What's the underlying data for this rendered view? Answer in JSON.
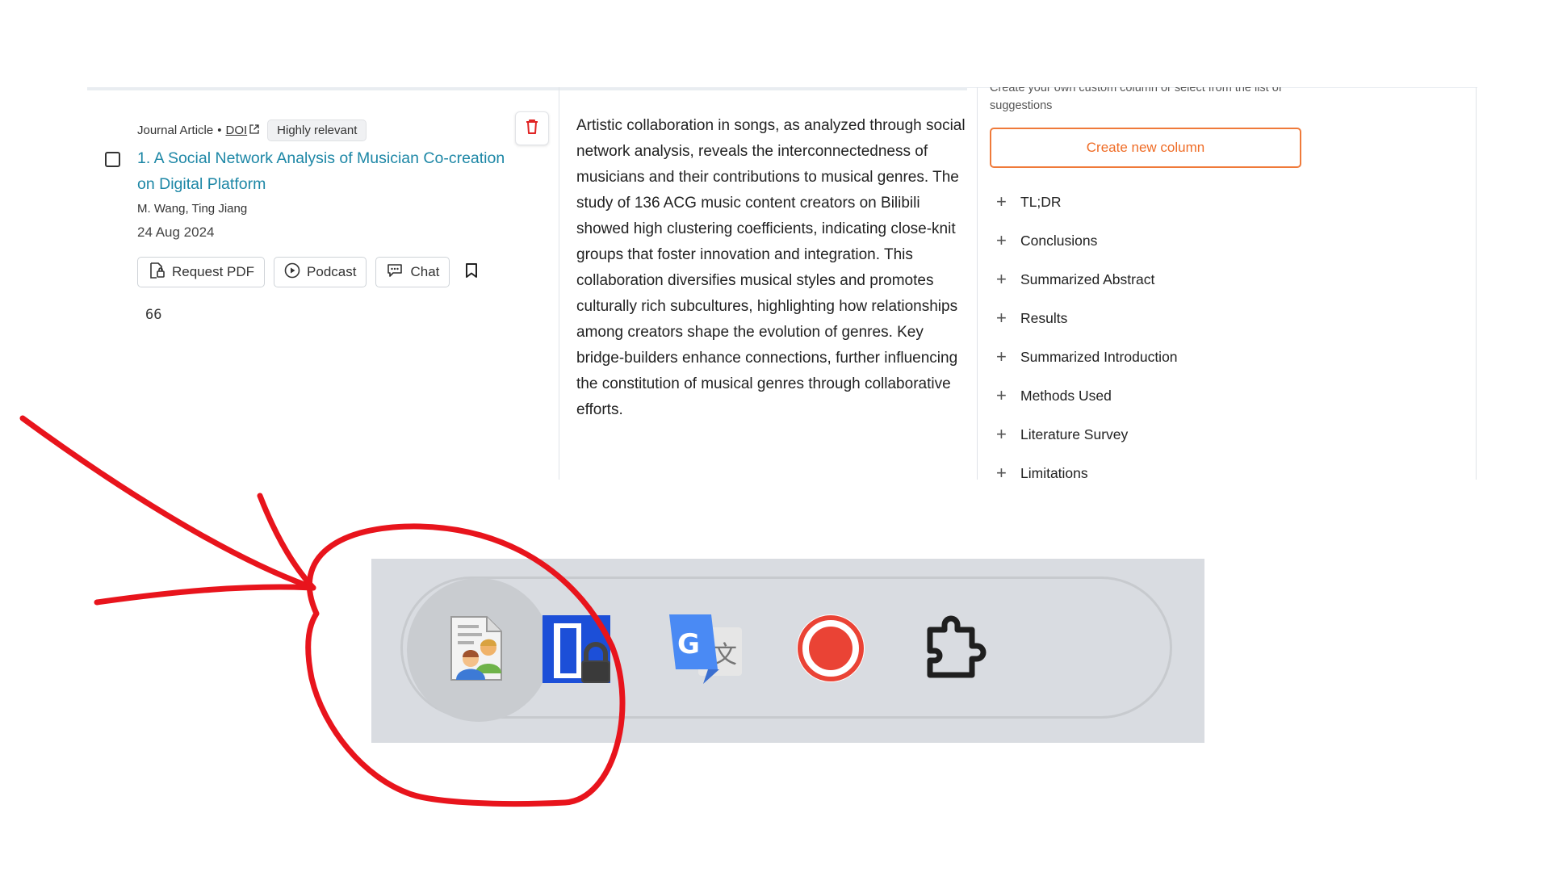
{
  "paper": {
    "type_label": "Journal Article",
    "separator": "•",
    "doi_label": "DOI",
    "relevance_badge": "Highly relevant",
    "title": "1. A Social Network Analysis of Musician Co-creation on Digital Platform",
    "authors": "M. Wang, Ting Jiang",
    "date": "24 Aug 2024",
    "actions": {
      "request_pdf": "Request PDF",
      "podcast": "Podcast",
      "chat": "Chat"
    },
    "citation_count": "66"
  },
  "summary_text": "Artistic collaboration in songs, as analyzed through social network analysis, reveals the interconnectedness of musicians and their contributions to musical genres. The study of 136 ACG music content creators on Bilibili showed high clustering coefficients, indicating close-knit groups that foster innovation and integration. This collaboration diversifies musical styles and promotes culturally rich subcultures, highlighting how relationships among creators shape the evolution of genres. Key bridge-builders enhance connections, further influencing the constitution of musical genres through collaborative efforts.",
  "column_panel": {
    "description": "Create your own custom column or select from the list of suggestions",
    "create_button": "Create new column",
    "suggestions": [
      "TL;DR",
      "Conclusions",
      "Summarized Abstract",
      "Results",
      "Summarized Introduction",
      "Methods Used",
      "Literature Survey",
      "Limitations"
    ]
  },
  "extensions": [
    {
      "icon": "contacts-document-icon",
      "active": true
    },
    {
      "icon": "bitwarden-lock-icon",
      "active": false
    },
    {
      "icon": "google-translate-icon",
      "active": false
    },
    {
      "icon": "screen-recorder-icon",
      "active": false
    },
    {
      "icon": "puzzle-extensions-icon",
      "active": false
    }
  ],
  "colors": {
    "title_link": "#1d87a6",
    "accent_orange": "#ef6c26",
    "delete_red": "#e02424",
    "annotation_red": "#e8141c",
    "toolbar_bg": "#d9dce1"
  }
}
